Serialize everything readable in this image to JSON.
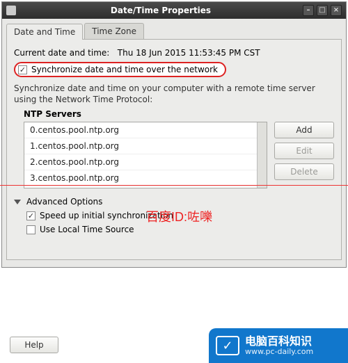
{
  "window": {
    "title": "Date/Time Properties",
    "minimize_glyph": "–",
    "maximize_glyph": "□",
    "close_glyph": "×"
  },
  "tabs": {
    "active": "Date and Time",
    "inactive": "Time Zone"
  },
  "datetime": {
    "label": "Current date and time:",
    "value": "Thu 18 Jun 2015 11:53:45 PM CST"
  },
  "sync_checkbox": {
    "checked_glyph": "✓",
    "label": "Synchronize date and time over the network"
  },
  "description": "Synchronize date and time on your computer with a remote time server using the Network Time Protocol:",
  "ntp": {
    "title": "NTP Servers",
    "items": [
      "0.centos.pool.ntp.org",
      "1.centos.pool.ntp.org",
      "2.centos.pool.ntp.org",
      "3.centos.pool.ntp.org"
    ],
    "buttons": {
      "add": "Add",
      "edit": "Edit",
      "delete": "Delete"
    }
  },
  "advanced": {
    "title": "Advanced Options",
    "speed_up": {
      "label": "Speed up initial synchronization",
      "checked_glyph": "✓"
    },
    "use_local": {
      "label": "Use Local Time Source",
      "checked_glyph": ""
    }
  },
  "help_button": "Help",
  "watermark_red": "百度ID:咗嚛",
  "footer": {
    "icon_glyph": "✓",
    "cn": "电脑百科知识",
    "url": "www.pc-daily.com"
  }
}
